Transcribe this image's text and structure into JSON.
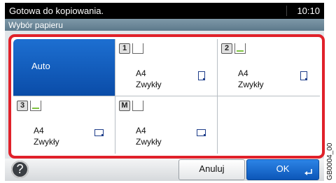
{
  "status_bar": {
    "message": "Gotowa do kopiowania.",
    "time": "10:10"
  },
  "title_bar": {
    "title": "Wybór papieru"
  },
  "paper_selection": {
    "auto": {
      "label": "Auto",
      "selected": true
    },
    "sources": [
      {
        "id": "cassette-1",
        "badge": "1",
        "size": "A4",
        "type": "Zwykły",
        "orientation": "portrait",
        "paper_color": "none"
      },
      {
        "id": "cassette-2",
        "badge": "2",
        "size": "A4",
        "type": "Zwykły",
        "orientation": "portrait",
        "paper_color": "#7fc241"
      },
      {
        "id": "cassette-3",
        "badge": "3",
        "size": "A4",
        "type": "Zwykły",
        "orientation": "landscape",
        "paper_color": "#7fc241"
      },
      {
        "id": "mp-tray",
        "badge": "M",
        "size": "A4",
        "type": "Zwykły",
        "orientation": "landscape",
        "paper_color": "none"
      }
    ]
  },
  "bottom_bar": {
    "help_label": "?",
    "cancel_label": "Anuluj",
    "ok_label": "OK"
  },
  "side_code": "GB0004_00",
  "colors": {
    "selection_frame": "#e0212a",
    "auto_selected": "#0a4ca8",
    "ok_button": "#0c56b8",
    "status_bar": "#000000"
  }
}
